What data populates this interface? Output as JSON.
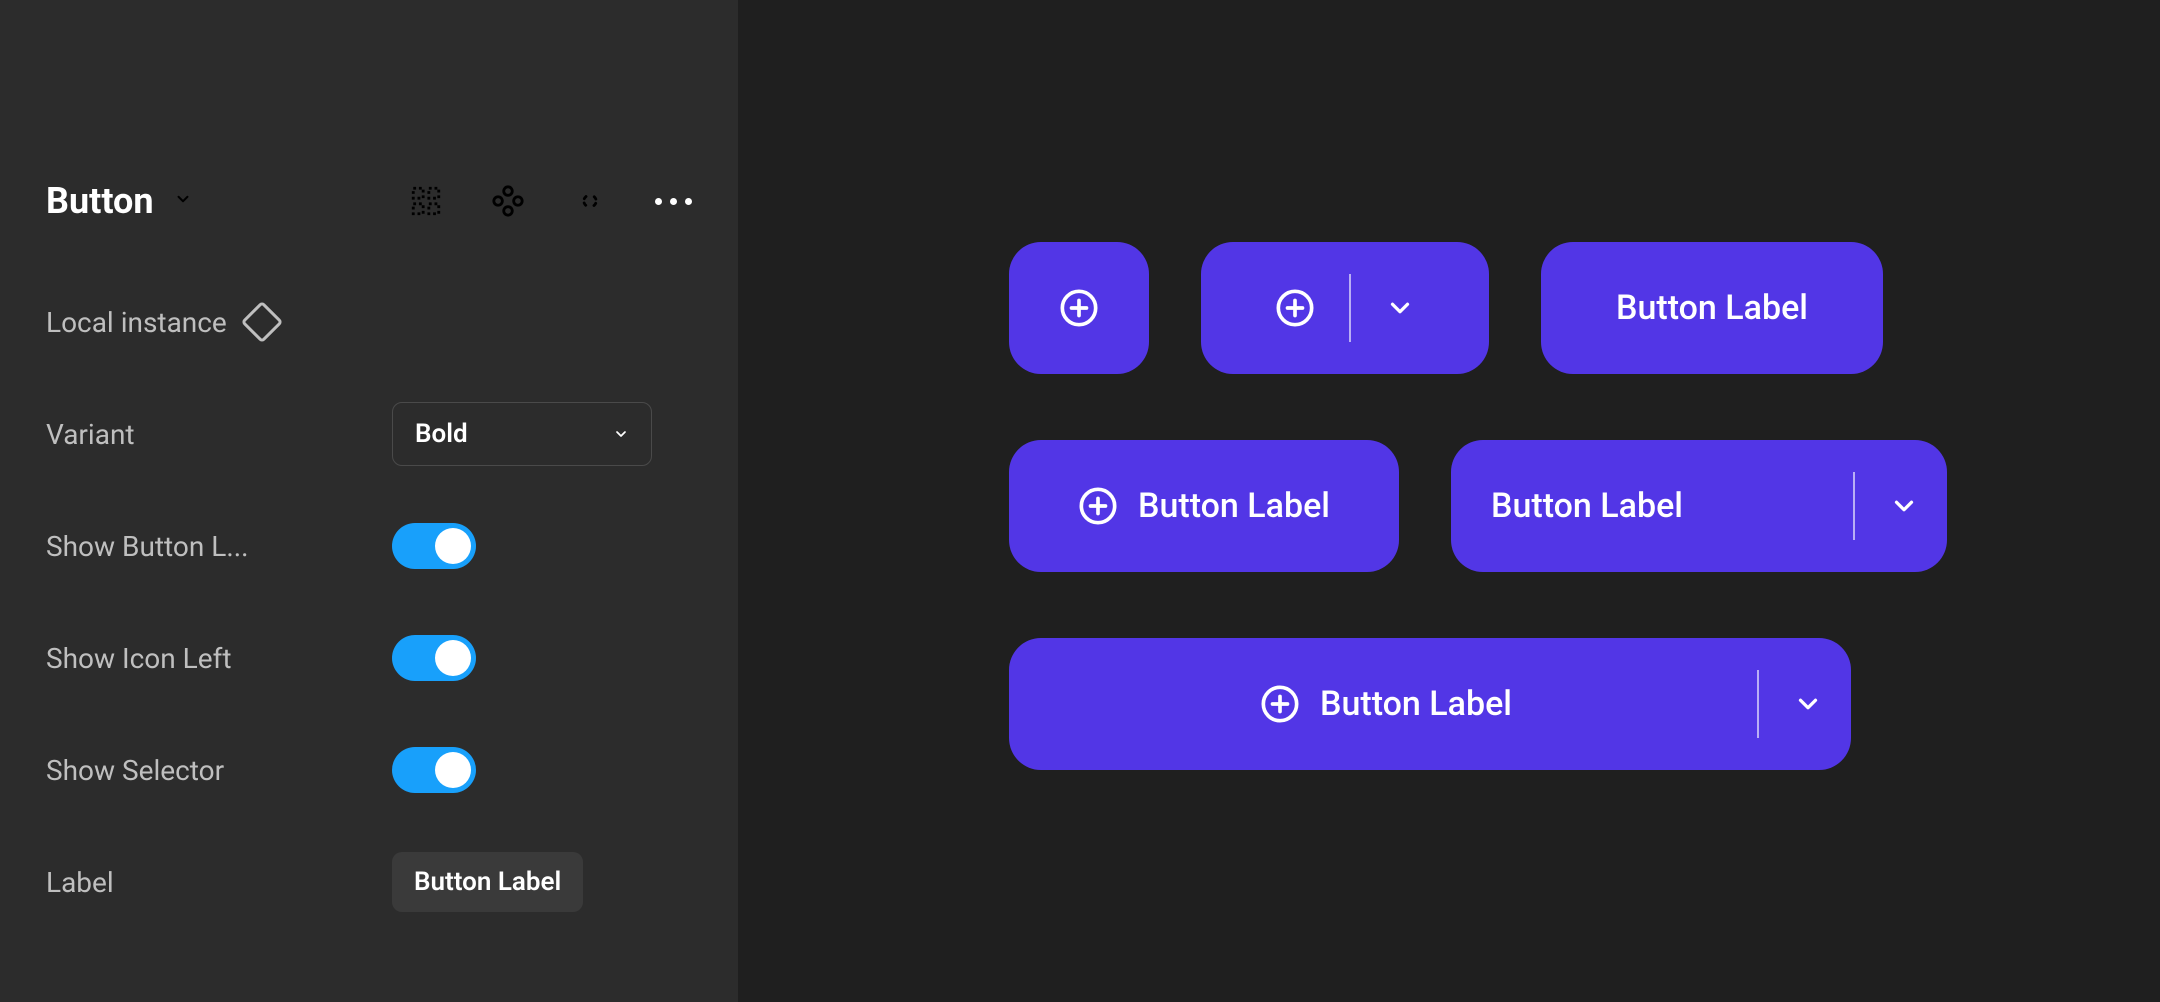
{
  "panel": {
    "title": "Button",
    "subtitle": "Local instance",
    "rows": {
      "variant_label": "Variant",
      "variant_value": "Bold",
      "show_button_label": "Show Button L...",
      "show_icon_left": "Show Icon Left",
      "show_selector": "Show Selector",
      "label_label": "Label",
      "label_value": "Button Label"
    }
  },
  "buttons": {
    "b3": "Button Label",
    "b4": "Button Label",
    "b5": "Button Label",
    "b6": "Button Label"
  },
  "colors": {
    "button_bg": "#5236e6",
    "panel_bg": "#2c2c2c",
    "canvas_bg": "#1f1f1f",
    "toggle_on": "#18a0fb"
  }
}
